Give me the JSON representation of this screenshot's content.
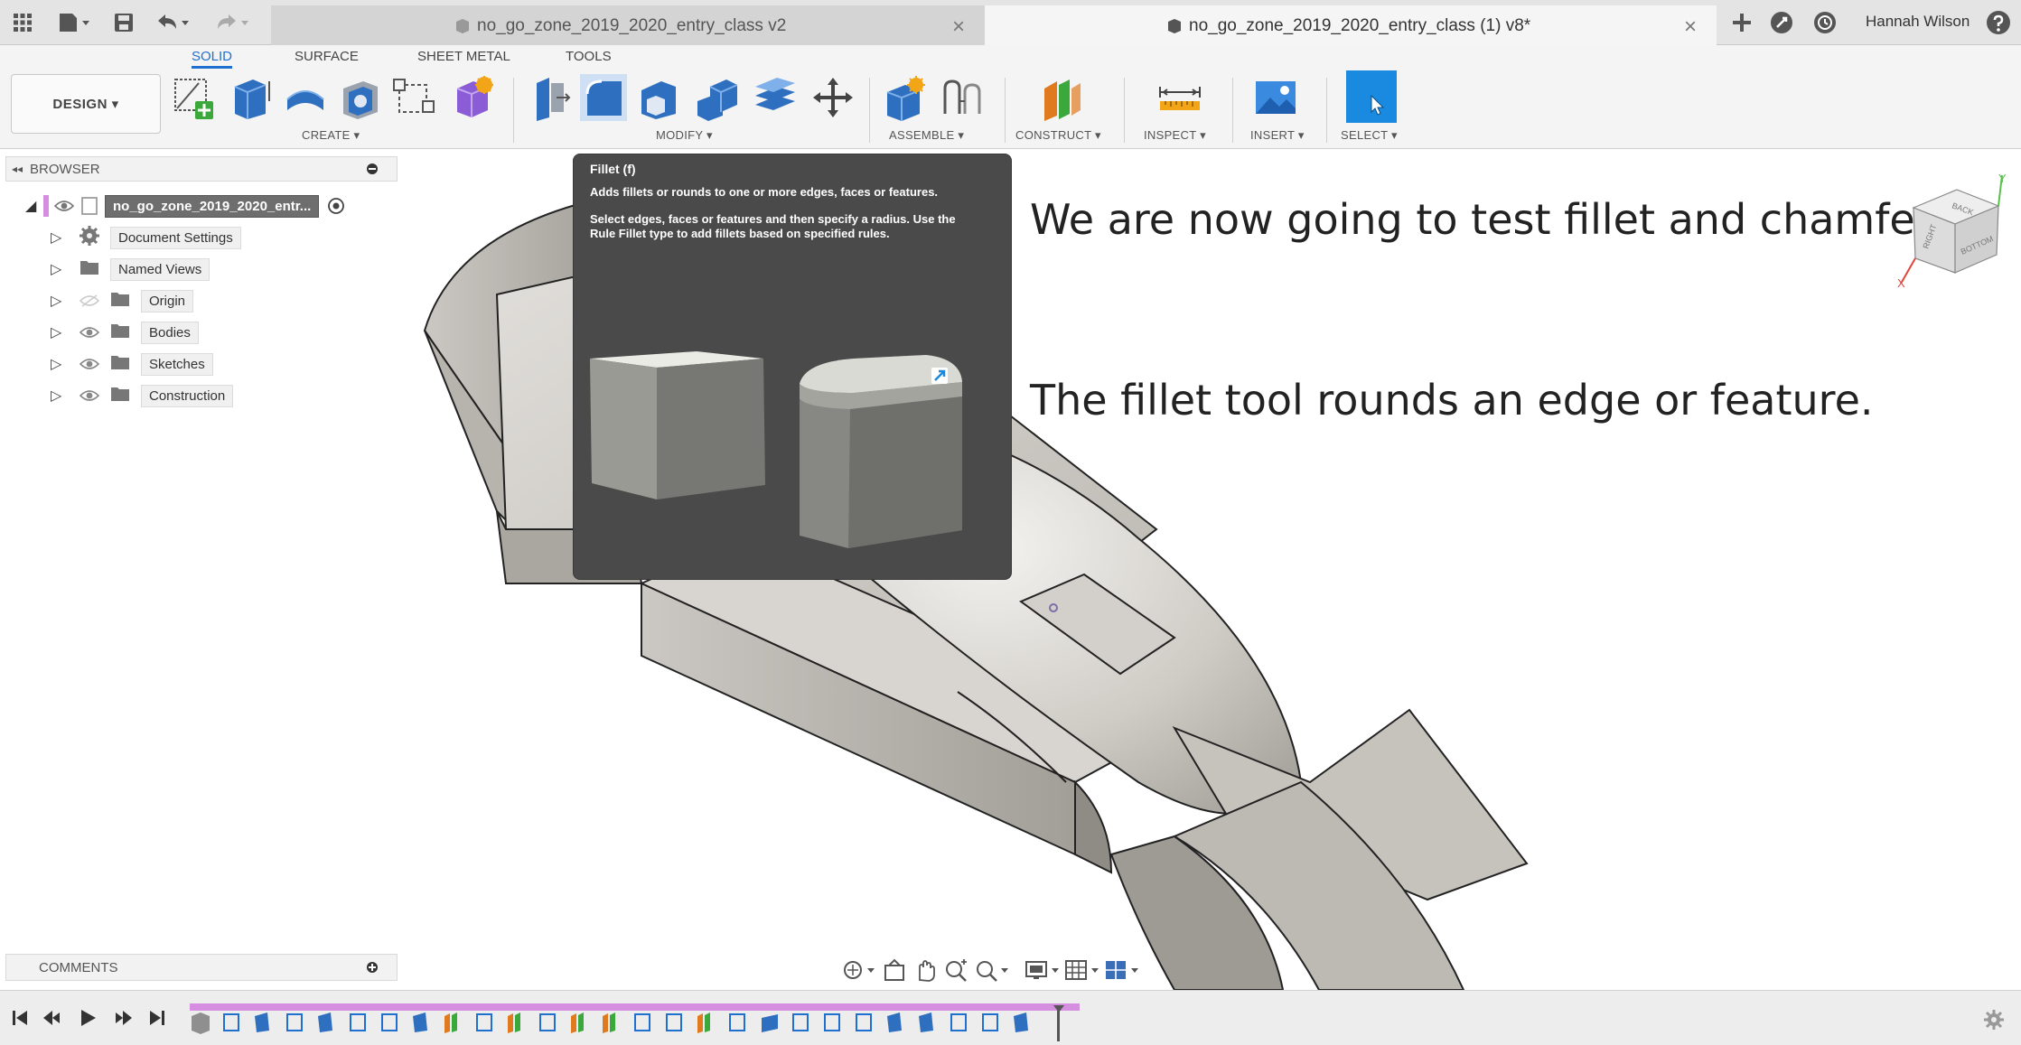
{
  "titlebar": {
    "tab_inactive": "no_go_zone_2019_2020_entry_class v2",
    "tab_active": "no_go_zone_2019_2020_entry_class (1) v8*",
    "user_name": "Hannah Wilson",
    "close_glyph": "×"
  },
  "toolbar": {
    "workspace_tabs": [
      "SOLID",
      "SURFACE",
      "SHEET METAL",
      "TOOLS"
    ],
    "active_tab": "SOLID",
    "design_label": "DESIGN ▾",
    "groups": {
      "create": "CREATE ▾",
      "modify": "MODIFY ▾",
      "assemble": "ASSEMBLE ▾",
      "construct": "CONSTRUCT ▾",
      "inspect": "INSPECT ▾",
      "insert": "INSERT ▾",
      "select": "SELECT ▾"
    }
  },
  "browser": {
    "header": "BROWSER",
    "root_label": "no_go_zone_2019_2020_entr...",
    "items": [
      {
        "label": "Document Settings"
      },
      {
        "label": "Named Views"
      },
      {
        "label": "Origin"
      },
      {
        "label": "Bodies"
      },
      {
        "label": "Sketches"
      },
      {
        "label": "Construction"
      }
    ]
  },
  "tooltip": {
    "title": "Fillet (f)",
    "line1": "Adds fillets or rounds to one or more edges, faces or features.",
    "line2": "Select edges, faces or features and then specify a radius. Use the Rule Fillet type to add fillets based on specified rules."
  },
  "narration": {
    "line1": "We are now going to test fillet and chamfer.",
    "line2": "The fillet tool rounds an edge or feature."
  },
  "view_cube": {
    "face_front": "RIGHT",
    "face_side": "BOTTOM",
    "face_top": "BACK",
    "axis_x": "X",
    "axis_y": "Y"
  },
  "comments": {
    "label": "COMMENTS"
  },
  "colors": {
    "accent_blue": "#1f6fd0",
    "timeline_pink": "#d68fe0",
    "tooltip_bg": "#4a4a4a",
    "model_grey": "#cdcac6"
  }
}
